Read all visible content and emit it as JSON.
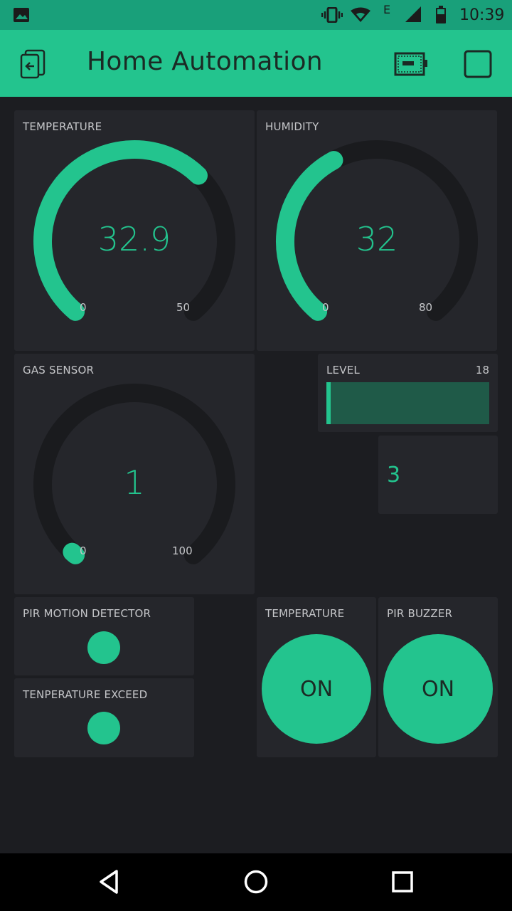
{
  "status_bar": {
    "time": "10:39",
    "network_label": "E",
    "icons": [
      "image-icon",
      "vibrate-icon",
      "wifi-icon",
      "signal-icon",
      "battery-icon"
    ]
  },
  "app_bar": {
    "title": "Home Automation",
    "icons": [
      "exit-icon",
      "device-icon",
      "stop-icon"
    ]
  },
  "widgets": {
    "temperature_gauge": {
      "label": "TEMPERATURE",
      "value": "32.9",
      "min": "0",
      "max": "50",
      "level": 0.658
    },
    "humidity_gauge": {
      "label": "HUMIDITY",
      "value": "32",
      "min": "0",
      "max": "80",
      "level": 0.4
    },
    "gas_gauge": {
      "label": "GAS SENSOR",
      "value": "1",
      "min": "0",
      "max": "100",
      "level": 0.01
    },
    "level_bar": {
      "label": "LEVEL",
      "value": "18",
      "level": 0.02
    },
    "value_display": {
      "value": "3"
    },
    "pir_led": {
      "label": "PIR MOTION DETECTOR"
    },
    "temp_exceed_led": {
      "label": "TENPERATURE EXCEED"
    },
    "temperature_button": {
      "label": "TEMPERATURE",
      "state": "ON"
    },
    "pir_buzzer_button": {
      "label": "PIR BUZZER",
      "state": "ON"
    }
  },
  "nav_bar": {
    "icons": [
      "back-icon",
      "home-icon",
      "recents-icon"
    ]
  },
  "colors": {
    "accent": "#23c48e",
    "background": "#1c1d21",
    "card": "#25262b",
    "track": "#1a1b1e",
    "text": "#c5c6c9"
  }
}
